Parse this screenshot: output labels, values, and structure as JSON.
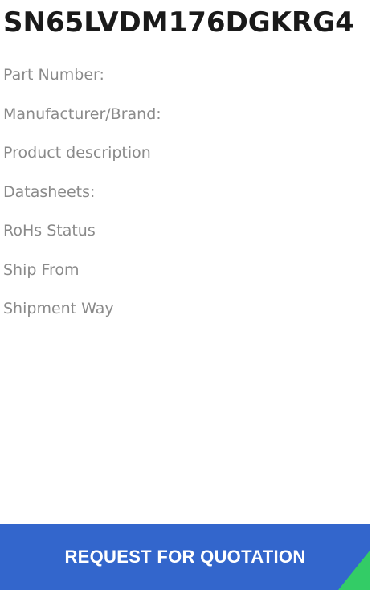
{
  "product": {
    "title": "SN65LVDM176DGKRG4"
  },
  "specs": [
    {
      "label": "Part Number:"
    },
    {
      "label": "Manufacturer/Brand:"
    },
    {
      "label": "Product description"
    },
    {
      "label": "Datasheets:"
    },
    {
      "label": "RoHs Status"
    },
    {
      "label": "Ship From"
    },
    {
      "label": "Shipment Way"
    }
  ],
  "cta": {
    "label": "REQUEST FOR QUOTATION",
    "color": "#3366cc",
    "accent_color": "#33cc66"
  }
}
